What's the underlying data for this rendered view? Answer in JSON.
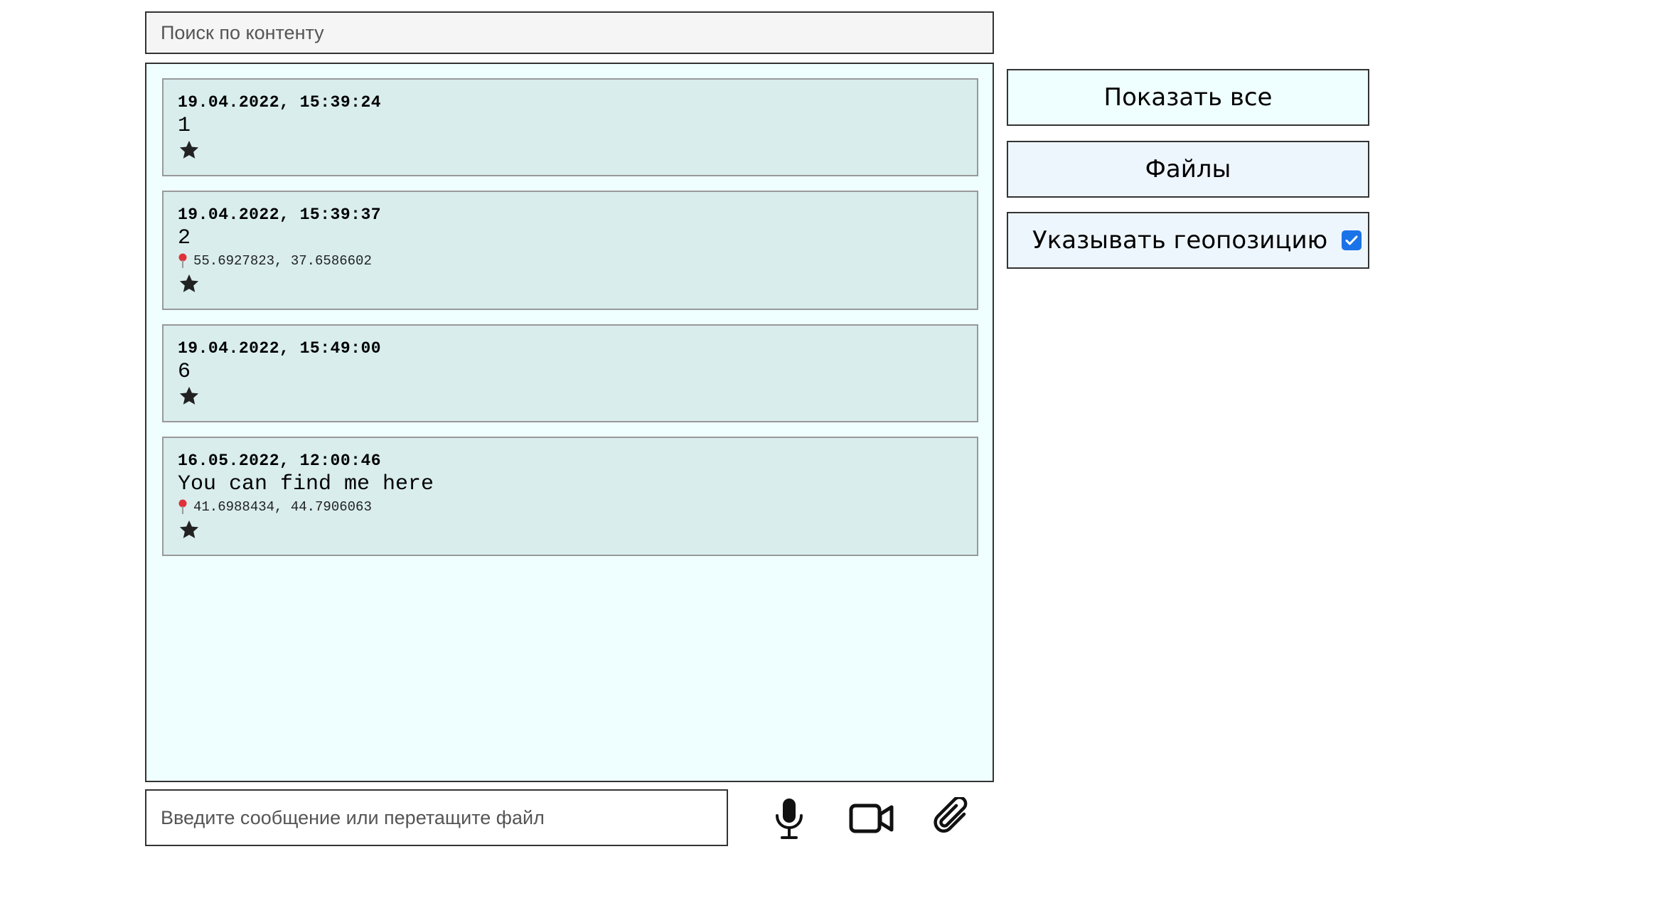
{
  "search": {
    "placeholder": "Поиск по контенту"
  },
  "messages": [
    {
      "date": "19.04.2022, 15:39:24",
      "text": "1",
      "geo": ""
    },
    {
      "date": "19.04.2022, 15:39:37",
      "text": "2",
      "geo": "55.6927823, 37.6586602"
    },
    {
      "date": "19.04.2022, 15:49:00",
      "text": "6",
      "geo": ""
    },
    {
      "date": "16.05.2022, 12:00:46",
      "text": "You can find me here",
      "geo": "41.6988434, 44.7906063"
    }
  ],
  "sidebar": {
    "show_all_label": "Показать все",
    "files_label": "Файлы",
    "geo_label": "Указывать геопозицию",
    "geo_checked": true
  },
  "composer": {
    "placeholder": "Введите сообщение или перетащите файл"
  },
  "icons": {
    "mic": "microphone-icon",
    "video": "video-camera-icon",
    "attach": "paperclip-icon",
    "star": "star-icon",
    "pin": "map-pin-icon"
  },
  "colors": {
    "feed_bg": "#effefe",
    "message_bg": "#d9eded",
    "checkbox": "#1a73e8",
    "pin": "#e0313a"
  }
}
